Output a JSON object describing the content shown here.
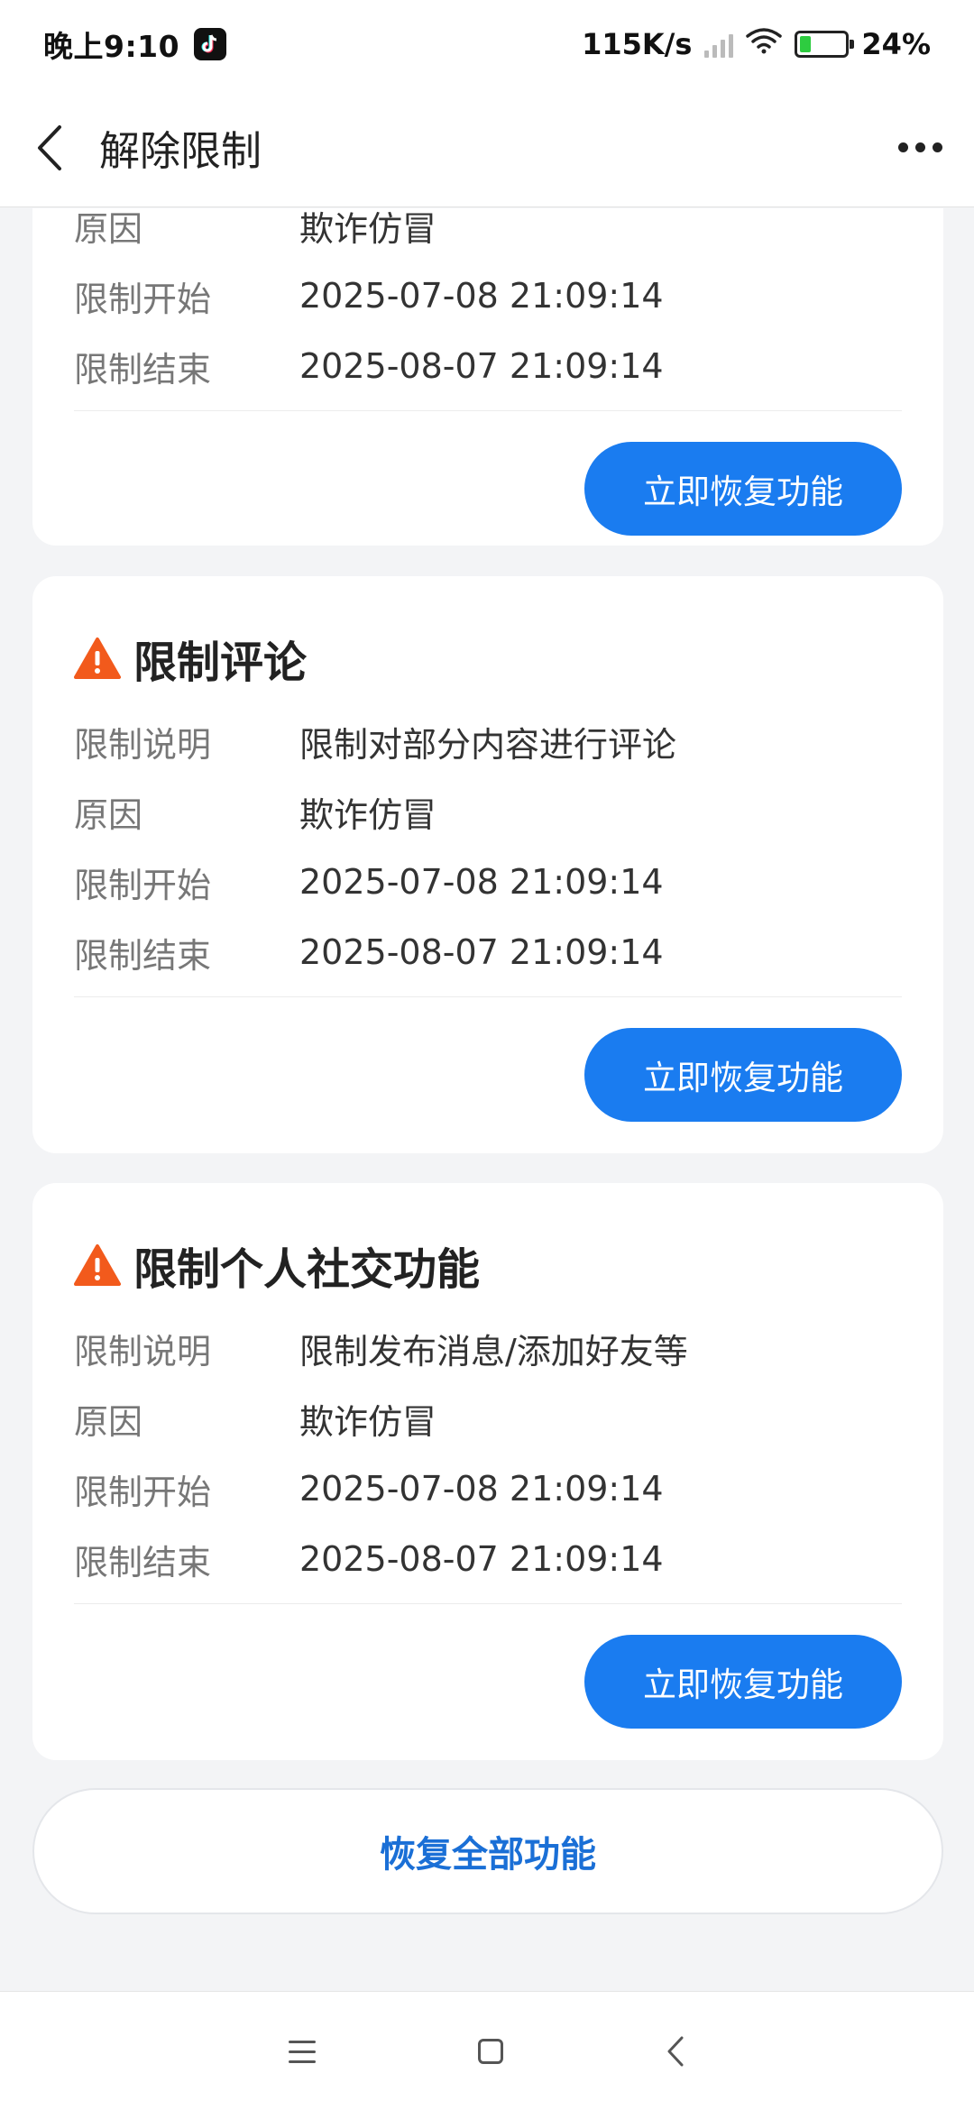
{
  "status_bar": {
    "time": "晚上9:10",
    "network_speed": "115K/s",
    "battery": "24%",
    "battery_level": 0.24
  },
  "header": {
    "title": "解除限制"
  },
  "first_card": {
    "reason_label": "原因",
    "reason_value": "欺诈仿冒",
    "start_label": "限制开始",
    "start_value": "2025-07-08 21:09:14",
    "end_label": "限制结束",
    "end_value": "2025-08-07 21:09:14",
    "button_label": "立即恢复功能"
  },
  "cards": [
    {
      "title": "限制评论",
      "desc_label": "限制说明",
      "desc_value": "限制对部分内容进行评论",
      "reason_label": "原因",
      "reason_value": "欺诈仿冒",
      "start_label": "限制开始",
      "start_value": "2025-07-08 21:09:14",
      "end_label": "限制结束",
      "end_value": "2025-08-07 21:09:14",
      "button_label": "立即恢复功能"
    },
    {
      "title": "限制个人社交功能",
      "desc_label": "限制说明",
      "desc_value": "限制发布消息/添加好友等",
      "reason_label": "原因",
      "reason_value": "欺诈仿冒",
      "start_label": "限制开始",
      "start_value": "2025-07-08 21:09:14",
      "end_label": "限制结束",
      "end_value": "2025-08-07 21:09:14",
      "button_label": "立即恢复功能"
    }
  ],
  "restore_all_label": "恢复全部功能",
  "colors": {
    "accent": "#1a7cf0",
    "warning": "#f25a1c",
    "label": "#777777"
  },
  "icons": [
    "back-arrow-icon",
    "more-icon",
    "warning-icon",
    "menu-icon",
    "home-icon",
    "back-icon"
  ]
}
